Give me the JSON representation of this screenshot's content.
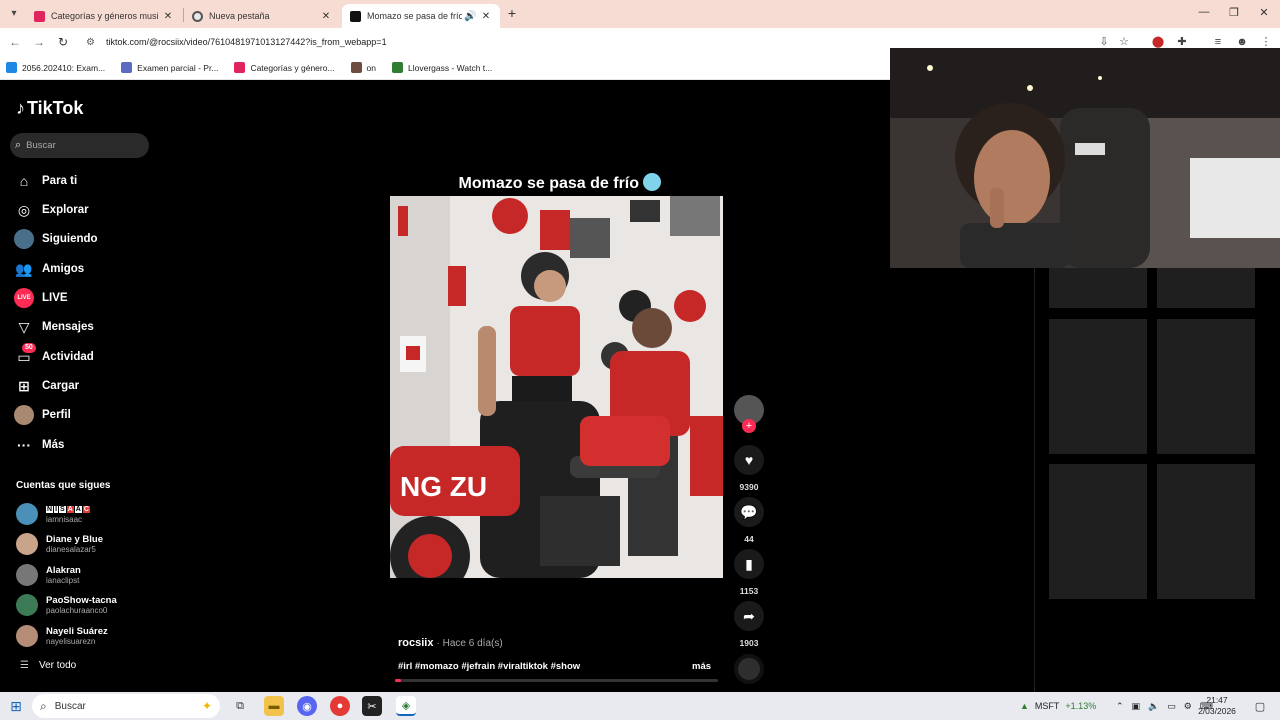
{
  "browser": {
    "tabs": [
      {
        "title": "Categorías y géneros musicales",
        "active": false,
        "fav_color": "#e0245e"
      },
      {
        "title": "Nueva pestaña",
        "active": false,
        "fav_color": "#555555"
      },
      {
        "title": "Momazo se pasa de frío: H",
        "active": true,
        "fav_color": "#111111"
      }
    ],
    "url": "tiktok.com/@rocsiix/video/7610481971013127442?is_from_webapp=1",
    "bookmarks": [
      {
        "label": "2056.202410: Exam...",
        "color": "#1e88e5"
      },
      {
        "label": "Examen parcial - Pr...",
        "color": "#5c6bc0"
      },
      {
        "label": "Categorías y género...",
        "color": "#e0245e"
      },
      {
        "label": "on",
        "color": "#6d4c41"
      },
      {
        "label": "Llovergass - Watch t...",
        "color": "#2e7d32"
      }
    ]
  },
  "tiktok": {
    "logo": "TikTok",
    "search_placeholder": "Buscar",
    "nav": [
      {
        "label": "Para ti",
        "icon": "home-icon"
      },
      {
        "label": "Explorar",
        "icon": "compass-icon"
      },
      {
        "label": "Siguiendo",
        "icon": "avatar-icon"
      },
      {
        "label": "Amigos",
        "icon": "friends-icon"
      },
      {
        "label": "LIVE",
        "icon": "live-icon"
      },
      {
        "label": "Mensajes",
        "icon": "send-icon"
      },
      {
        "label": "Actividad",
        "icon": "inbox-icon",
        "badge": "50"
      },
      {
        "label": "Cargar",
        "icon": "upload-icon"
      },
      {
        "label": "Perfil",
        "icon": "profile-icon"
      },
      {
        "label": "Más",
        "icon": "more-icon"
      }
    ],
    "following_title": "Cuentas que sigues",
    "following": [
      {
        "name": "NISAAC",
        "user": "iamnisaac",
        "color": "#4a90b8"
      },
      {
        "name": "Diane y Blue",
        "user": "dianesalazar5",
        "color": "#c9a38a"
      },
      {
        "name": "Alakran",
        "user": "ianaclipst",
        "color": "#777777"
      },
      {
        "name": "PaoShow-tacna",
        "user": "paolachuraanco0",
        "color": "#3d7a56"
      },
      {
        "name": "Nayeli Suárez",
        "user": "nayelisuarezn",
        "color": "#b58c76"
      }
    ],
    "see_all": "Ver todo",
    "video": {
      "title": "Momazo se pasa de frío",
      "author": "rocsiix",
      "ago": "· Hace 6 día(s)",
      "tags": "#irl #momazo #jefrain #viraltiktok #show",
      "more": "más",
      "likes": "9390",
      "comments": "44",
      "saves": "1153",
      "shares": "1903",
      "progress": 0.02
    }
  },
  "taskbar": {
    "search": "Buscar",
    "stock_name": "MSFT",
    "stock_change": "+1.13%",
    "time": "21:47",
    "date": "2/03/2026"
  }
}
